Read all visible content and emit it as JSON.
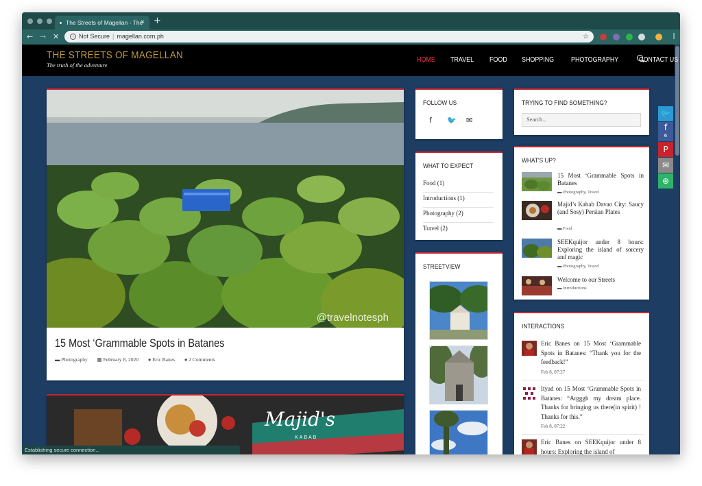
{
  "browser": {
    "tab_title": "The Streets of Magellan - The",
    "tab_close": "×",
    "new_tab": "+",
    "back": "←",
    "forward": "→",
    "stop": "✕",
    "security_label": "Not Secure",
    "url": "magellan.com.ph",
    "bookmark_star": "☆",
    "menu": "⋮",
    "status_text": "Establishing secure connection..."
  },
  "site": {
    "title": "THE STREETS OF MAGELLAN",
    "tagline": "The truth of the adventure",
    "nav": [
      "HOME",
      "TRAVEL",
      "FOOD",
      "SHOPPING",
      "PHOTOGRAPHY",
      "CONTACT US"
    ],
    "active_nav": "HOME",
    "colors": {
      "accent": "#c6262e",
      "brand_gold": "#c29a3e",
      "page_bg": "#1d3d63"
    }
  },
  "posts": [
    {
      "title": "15 Most ‘Grammable Spots in Batanes",
      "watermark": "@travelnotesph",
      "category": "Photography",
      "date": "February 8, 2020",
      "author": "Eric Banes",
      "comments": "2 Comments"
    },
    {
      "image_title": "Majid's",
      "image_subtitle": "KABAB"
    }
  ],
  "follow": {
    "title": "FOLLOW US",
    "icons": [
      "facebook-icon",
      "twitter-icon",
      "envelope-icon"
    ],
    "glyphs": [
      "f",
      "🐦",
      "✉"
    ]
  },
  "expect": {
    "title": "WHAT TO EXPECT",
    "items": [
      "Food (1)",
      "Introductions (1)",
      "Photography (2)",
      "Travel (2)"
    ]
  },
  "streetview": {
    "title": "STREETVIEW"
  },
  "search": {
    "title": "TRYING TO FIND SOMETHING?",
    "placeholder": "Search..."
  },
  "whatsup": {
    "title": "WHAT'S UP?",
    "items": [
      {
        "title": "15 Most ‘Grammable Spots in Batanes",
        "cats": "Photography, Travel"
      },
      {
        "title": "Majid’s Kabab Davao City: Saucy (and Sosy) Persian Plates",
        "cats": "Food"
      },
      {
        "title": "SEEKquijor under 8 hours: Exploring the island of sor­cery and magic",
        "cats": "Photography, Travel"
      },
      {
        "title": "Welcome to our Streets",
        "cats": "Introductions"
      }
    ]
  },
  "interactions": {
    "title": "INTERACTIONS",
    "items": [
      {
        "text": "Eric Banes on 15 Most ‘Grammable Spots in Batanes: “Thank you for the feedback!”",
        "date": "Feb 8, 07:27"
      },
      {
        "text": "Ityad on 15 Most ‘Grammable Spots in Batanes: “Argggh my dream place. Thanks for bringing us there(in spirit) ! Thanks for this.”",
        "date": "Feb 8, 07:22"
      },
      {
        "text": "Eric Banes on SEEKquijor under 8 hours: Exploring the island of",
        "date": ""
      }
    ]
  },
  "share": {
    "facebook_count": "6",
    "icons": [
      "twitter-icon",
      "facebook-icon",
      "pinterest-icon",
      "email-icon",
      "more-share-icon"
    ],
    "glyphs": [
      "🐦",
      "f",
      "P",
      "✉",
      "⊕"
    ]
  }
}
